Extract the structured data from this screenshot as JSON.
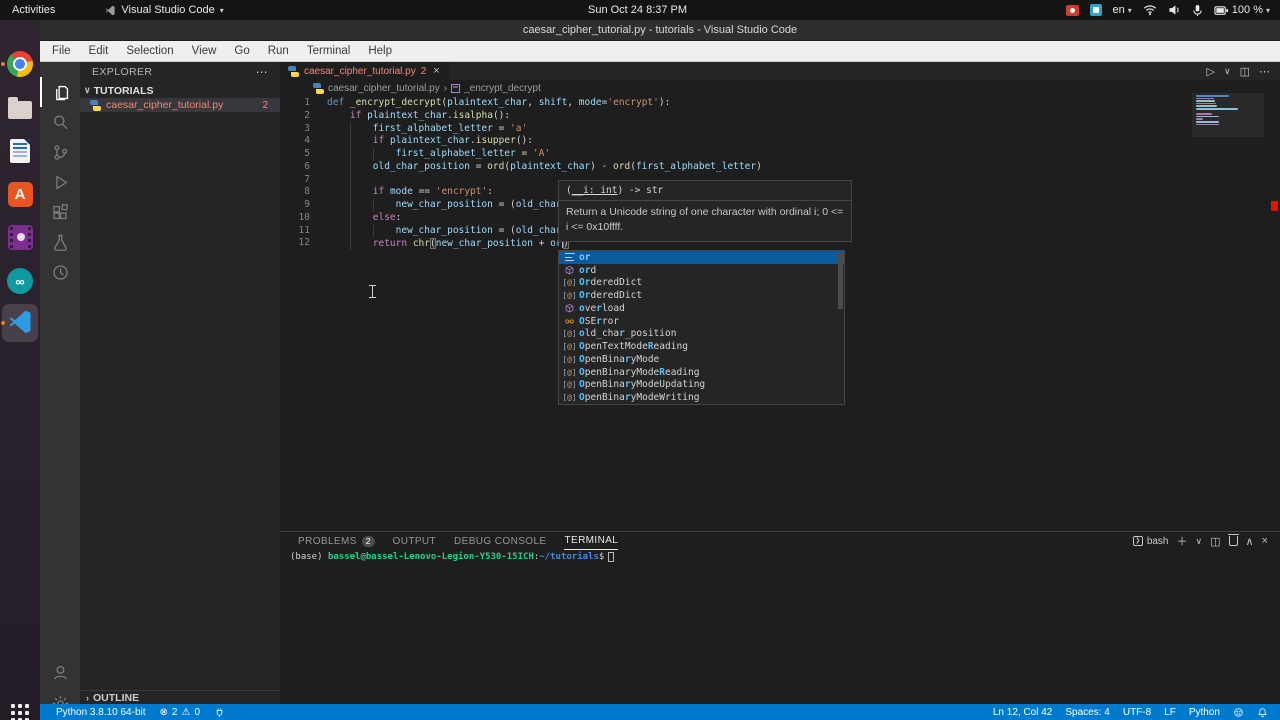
{
  "colors": {
    "accent": "#007acc",
    "editor_bg": "#1e1e1e",
    "sidebar_bg": "#252526",
    "activitybar_bg": "#333333",
    "error": "#f48771",
    "suggest_selection": "#0a5aa0",
    "match_highlight": "#4fc3ff",
    "terminal_green": "#23d18b",
    "terminal_blue": "#3b8eea"
  },
  "top_bar": {
    "activities": "Activities",
    "app_name": "Visual Studio Code",
    "app_caret": "▾",
    "clock": "Sun Oct 24  8:37 PM",
    "input_language": "en",
    "battery_percent": "100 %",
    "tray_caret": "▾",
    "tray_icons": [
      "screen-recorder",
      "blue-indicator",
      "input-language",
      "wifi",
      "volume",
      "microphone",
      "battery"
    ]
  },
  "dock": {
    "items": [
      {
        "name": "chrome",
        "running": true
      },
      {
        "name": "files",
        "running": false
      },
      {
        "name": "libreoffice-writer",
        "running": false
      },
      {
        "name": "ubuntu-software",
        "running": false
      },
      {
        "name": "video-app",
        "running": false
      },
      {
        "name": "arduino",
        "running": false
      },
      {
        "name": "vscode",
        "running": true,
        "focused": true
      }
    ],
    "show_apps": "show-applications"
  },
  "window": {
    "title": "caesar_cipher_tutorial.py - tutorials - Visual Studio Code"
  },
  "menu_bar": {
    "items": [
      "File",
      "Edit",
      "Selection",
      "View",
      "Go",
      "Run",
      "Terminal",
      "Help"
    ]
  },
  "activity_bar": {
    "top": [
      "explorer",
      "search",
      "source-control",
      "run-debug",
      "extensions",
      "testing",
      "timeline"
    ],
    "active": "explorer",
    "bottom": [
      "account",
      "settings"
    ]
  },
  "sidebar": {
    "header": "EXPLORER",
    "header_more": "⋯",
    "section": {
      "chevron": "∨",
      "label": "TUTORIALS"
    },
    "file": {
      "name": "caesar_cipher_tutorial.py",
      "badge": "2"
    },
    "outline": {
      "chevron": "›",
      "label": "OUTLINE"
    }
  },
  "editor": {
    "tab": {
      "name": "caesar_cipher_tutorial.py",
      "badge": "2",
      "close": "×"
    },
    "actions": {
      "run": "▷",
      "run_caret": "∨",
      "split": "◫",
      "more": "⋯"
    },
    "breadcrumb": {
      "file": "caesar_cipher_tutorial.py",
      "separator": "›",
      "symbol": "_encrypt_decrypt"
    },
    "code_lines": [
      {
        "n": "1",
        "t": [
          [
            "def",
            "kw"
          ],
          [
            " ",
            "pun"
          ],
          [
            "_encrypt_decrypt",
            "fn"
          ],
          [
            "(",
            "pun"
          ],
          [
            "plaintext_char",
            "var"
          ],
          [
            ", ",
            "pun"
          ],
          [
            "shift",
            "var"
          ],
          [
            ", ",
            "pun"
          ],
          [
            "mode",
            "var"
          ],
          [
            "=",
            "pun"
          ],
          [
            "'encrypt'",
            "str"
          ],
          [
            "):",
            "pun"
          ]
        ]
      },
      {
        "n": "2",
        "t": [
          [
            "    ",
            "pun"
          ],
          [
            "if",
            "ctrl"
          ],
          [
            " ",
            "pun"
          ],
          [
            "plaintext_char",
            "var"
          ],
          [
            ".",
            "pun"
          ],
          [
            "isalpha",
            "fn"
          ],
          [
            "():",
            "pun"
          ]
        ]
      },
      {
        "n": "3",
        "t": [
          [
            "        ",
            "pun"
          ],
          [
            "first_alphabet_letter",
            "var"
          ],
          [
            " = ",
            "pun"
          ],
          [
            "'a'",
            "str"
          ]
        ]
      },
      {
        "n": "4",
        "t": [
          [
            "        ",
            "pun"
          ],
          [
            "if",
            "ctrl"
          ],
          [
            " ",
            "pun"
          ],
          [
            "plaintext_char",
            "var"
          ],
          [
            ".",
            "pun"
          ],
          [
            "isupper",
            "fn"
          ],
          [
            "():",
            "pun"
          ]
        ]
      },
      {
        "n": "5",
        "t": [
          [
            "            ",
            "pun"
          ],
          [
            "first_alphabet_letter",
            "var"
          ],
          [
            " = ",
            "pun"
          ],
          [
            "'A'",
            "str"
          ]
        ]
      },
      {
        "n": "6",
        "t": [
          [
            "        ",
            "pun"
          ],
          [
            "old_char_position",
            "var"
          ],
          [
            " = ",
            "pun"
          ],
          [
            "ord",
            "fn"
          ],
          [
            "(",
            "pun"
          ],
          [
            "plaintext_char",
            "var"
          ],
          [
            ") - ",
            "pun"
          ],
          [
            "ord",
            "fn"
          ],
          [
            "(",
            "pun"
          ],
          [
            "first_alphabet_letter",
            "var"
          ],
          [
            ")",
            "pun"
          ]
        ]
      },
      {
        "n": "7",
        "t": []
      },
      {
        "n": "8",
        "t": [
          [
            "        ",
            "pun"
          ],
          [
            "if",
            "ctrl"
          ],
          [
            " ",
            "pun"
          ],
          [
            "mode",
            "var"
          ],
          [
            " == ",
            "pun"
          ],
          [
            "'encrypt'",
            "str"
          ],
          [
            ":",
            "pun"
          ]
        ]
      },
      {
        "n": "9",
        "t": [
          [
            "            ",
            "pun"
          ],
          [
            "new_char_position",
            "var"
          ],
          [
            " = (",
            "pun"
          ],
          [
            "old_char",
            "var"
          ]
        ]
      },
      {
        "n": "10",
        "t": [
          [
            "        ",
            "pun"
          ],
          [
            "else",
            "ctrl"
          ],
          [
            ":",
            "pun"
          ]
        ]
      },
      {
        "n": "11",
        "t": [
          [
            "            ",
            "pun"
          ],
          [
            "new_char_position",
            "var"
          ],
          [
            " = (",
            "pun"
          ],
          [
            "old_char",
            "var"
          ]
        ]
      },
      {
        "n": "12",
        "t": [
          [
            "        ",
            "pun"
          ],
          [
            "return",
            "ctrl"
          ],
          [
            " ",
            "pun"
          ],
          [
            "chr",
            "fn"
          ],
          [
            "(",
            "brk"
          ],
          [
            "new_char_position",
            "var"
          ],
          [
            " + ",
            "pun"
          ],
          [
            "or",
            "var"
          ],
          [
            "",
            "cur"
          ],
          [
            ")",
            "brk"
          ]
        ]
      }
    ],
    "hover": {
      "sig_pre": "(",
      "sig_param": "__i: int",
      "sig_post": ") -> str",
      "doc": "Return a Unicode string of one character with ordinal i; 0 <= i <= 0x10ffff."
    },
    "suggest": {
      "items": [
        {
          "label": "or",
          "icon": "keyword",
          "match": [
            0,
            1
          ],
          "selected": true
        },
        {
          "label": "ord",
          "icon": "method",
          "match": [
            0,
            1
          ]
        },
        {
          "label": "OrderedDict",
          "icon": "value",
          "match": [
            0,
            1
          ]
        },
        {
          "label": "OrderedDict",
          "icon": "value",
          "match": [
            0,
            1
          ]
        },
        {
          "label": "overload",
          "icon": "method",
          "match": [
            0,
            3
          ]
        },
        {
          "label": "OSError",
          "icon": "class",
          "match": [
            0,
            3
          ]
        },
        {
          "label": "old_char_position",
          "icon": "value",
          "match": [
            0,
            7
          ]
        },
        {
          "label": "OpenTextModeReading",
          "icon": "value",
          "match": [
            0,
            12
          ]
        },
        {
          "label": "OpenBinaryMode",
          "icon": "value",
          "match": [
            0,
            8
          ]
        },
        {
          "label": "OpenBinaryModeReading",
          "icon": "value",
          "match": [
            0,
            14
          ]
        },
        {
          "label": "OpenBinaryModeUpdating",
          "icon": "value",
          "match": [
            0,
            8
          ]
        },
        {
          "label": "OpenBinaryModeWriting",
          "icon": "value",
          "match": [
            0,
            8
          ]
        }
      ]
    }
  },
  "panel": {
    "tabs": [
      {
        "label": "PROBLEMS",
        "badge": "2"
      },
      {
        "label": "OUTPUT"
      },
      {
        "label": "DEBUG CONSOLE"
      },
      {
        "label": "TERMINAL",
        "active": true
      }
    ],
    "controls": {
      "shell": "bash",
      "new": "＋",
      "caret": "∨",
      "split": "◫",
      "maximize": "∧",
      "close": "×"
    },
    "terminal": {
      "prefix": "(base) ",
      "user": "bassel@bassel-Lenovo-Legion-Y530-15ICH",
      "sep": ":",
      "path": "~/tutorials",
      "prompt_char": "$"
    }
  },
  "status_bar": {
    "left": [
      {
        "type": "text",
        "name": "python-interpreter",
        "text": "Python 3.8.10 64-bit"
      },
      {
        "type": "problems",
        "errors": "2",
        "warnings": "0"
      },
      {
        "type": "icon",
        "name": "plug-icon"
      }
    ],
    "right": [
      {
        "type": "text",
        "name": "cursor-position",
        "text": "Ln 12, Col 42"
      },
      {
        "type": "text",
        "name": "indentation",
        "text": "Spaces: 4"
      },
      {
        "type": "text",
        "name": "encoding",
        "text": "UTF-8"
      },
      {
        "type": "text",
        "name": "eol",
        "text": "LF"
      },
      {
        "type": "text",
        "name": "language-mode",
        "text": "Python"
      },
      {
        "type": "icon",
        "name": "feedback-smiley-icon"
      },
      {
        "type": "icon",
        "name": "bell-icon"
      }
    ]
  }
}
